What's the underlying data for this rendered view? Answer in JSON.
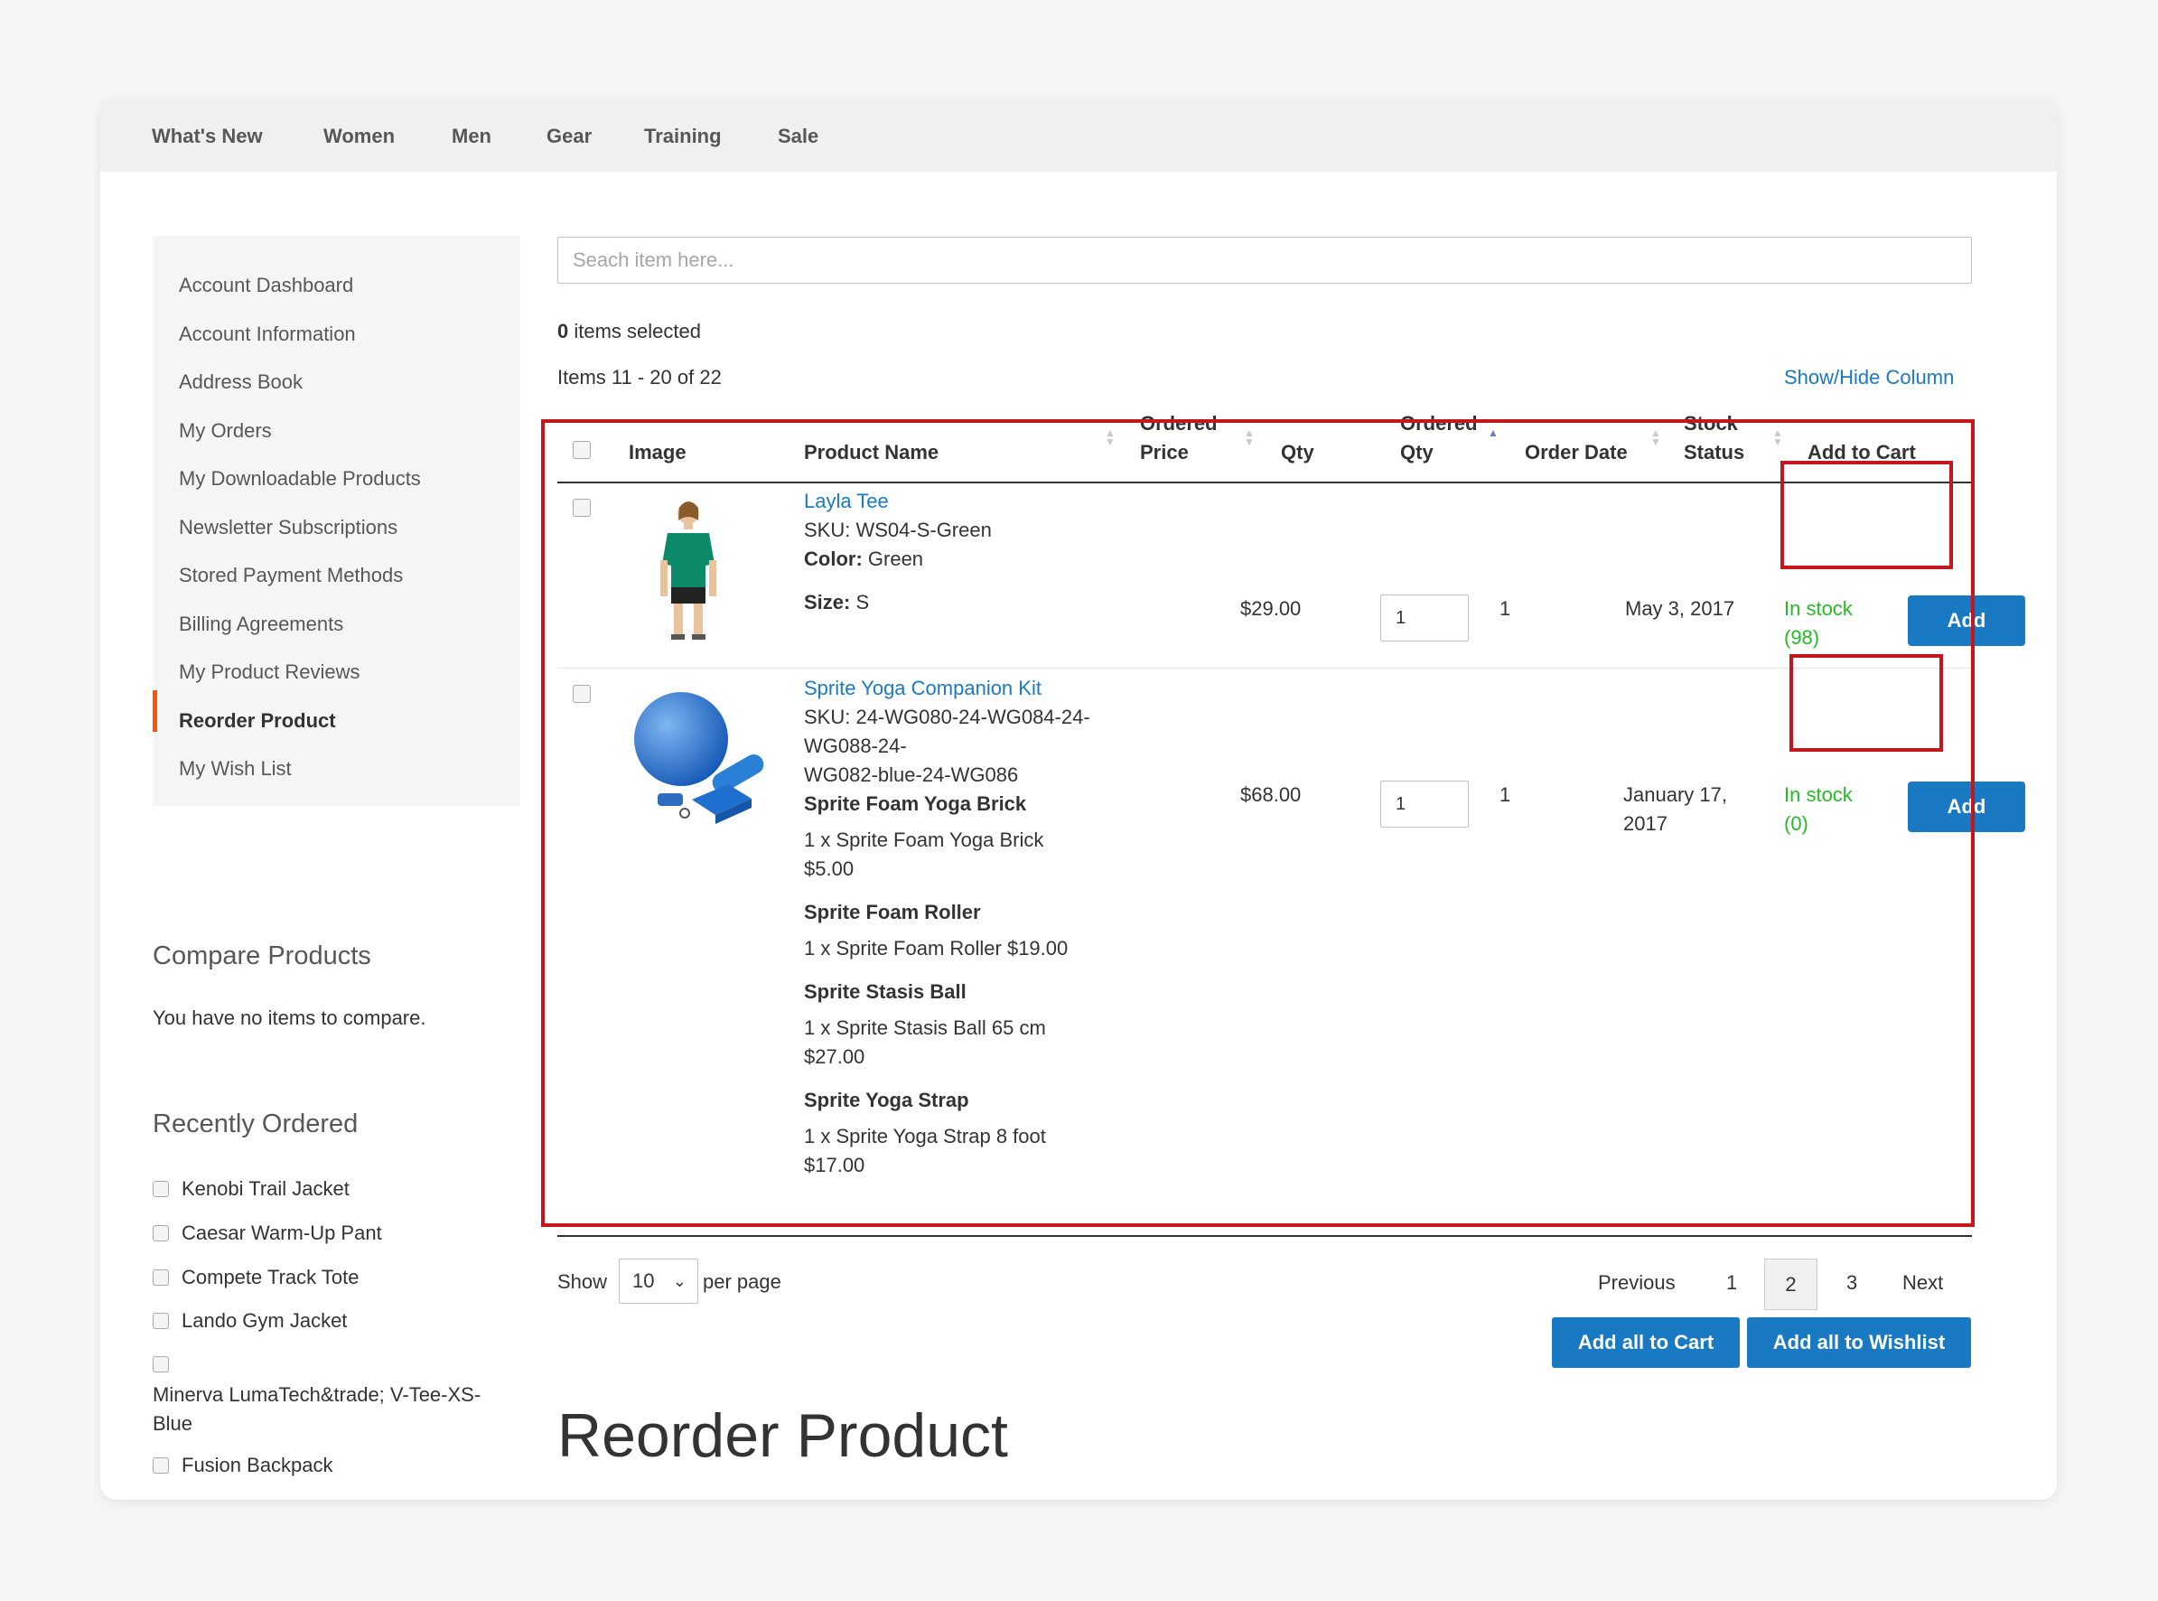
{
  "nav": {
    "items": [
      "What's New",
      "Women",
      "Men",
      "Gear",
      "Training",
      "Sale"
    ]
  },
  "sidebar": {
    "items": [
      "Account Dashboard",
      "Account Information",
      "Address Book",
      "My Orders",
      "My Downloadable Products",
      "Newsletter Subscriptions",
      "Stored Payment Methods",
      "Billing Agreements",
      "My Product Reviews",
      "Reorder Product",
      "My Wish List"
    ],
    "active": "Reorder Product"
  },
  "compare": {
    "title": "Compare Products",
    "empty_text": "You have no items to compare."
  },
  "recently_ordered": {
    "title": "Recently Ordered",
    "items": [
      "Kenobi Trail Jacket",
      "Caesar Warm-Up Pant",
      "Compete Track Tote",
      "Lando Gym Jacket",
      "Minerva LumaTech&trade; V-Tee-XS-Blue",
      "Fusion Backpack"
    ]
  },
  "search": {
    "placeholder": "Seach item here..."
  },
  "selection": {
    "count": "0",
    "label": " items selected"
  },
  "items_count": "Items 11 - 20 of 22",
  "show_hide": "Show/Hide Column",
  "table": {
    "headers": {
      "image": "Image",
      "product_name": "Product Name",
      "ordered_price_1": "Ordered",
      "ordered_price_2": "Price",
      "qty": "Qty",
      "ordered_qty_1": "Ordered",
      "ordered_qty_2": "Qty",
      "order_date": "Order Date",
      "stock_status_1": "Stock",
      "stock_status_2": "Status",
      "add_to_cart": "Add to Cart"
    },
    "rows": [
      {
        "name": "Layla Tee",
        "sku": "SKU: WS04-S-Green",
        "color_label": "Color:",
        "color": "Green",
        "size_label": "Size:",
        "size": "S",
        "price": "$29.00",
        "qty": "1",
        "ordered_qty": "1",
        "date": "May 3, 2017",
        "stock_line1": "In stock",
        "stock_line2": "(98)",
        "add": "Add"
      },
      {
        "name": "Sprite Yoga Companion Kit",
        "sku_lines": [
          "SKU: 24-WG080-24-WG084-24-",
          "WG088-24-",
          "WG082-blue-24-WG086"
        ],
        "bundle": [
          {
            "title": "Sprite Foam Yoga Brick",
            "lines": [
              "1 x Sprite Foam Yoga Brick",
              "$5.00"
            ]
          },
          {
            "title": "Sprite Foam Roller",
            "lines": [
              "1 x Sprite Foam Roller $19.00"
            ]
          },
          {
            "title": "Sprite Stasis Ball",
            "lines": [
              "1 x Sprite Stasis Ball 65 cm",
              "$27.00"
            ]
          },
          {
            "title": "Sprite Yoga Strap",
            "lines": [
              "1 x Sprite Yoga Strap 8 foot",
              "$17.00"
            ]
          }
        ],
        "price": "$68.00",
        "qty": "1",
        "ordered_qty": "1",
        "date_lines": [
          "January 17,",
          "2017"
        ],
        "stock_line1": "In stock",
        "stock_line2": "(0)",
        "add": "Add"
      }
    ]
  },
  "toolbar": {
    "show": "Show",
    "limiter": "10",
    "per_page": "per page",
    "previous": "Previous",
    "pages": [
      "1",
      "2",
      "3"
    ],
    "current_page": "2",
    "next": "Next",
    "add_all_cart": "Add all to Cart",
    "add_all_wishlist": "Add all to Wishlist"
  },
  "page_title": "Reorder Product",
  "colors": {
    "accent": "#1979c3",
    "instock": "#22bd22",
    "highlight": "#c4161c",
    "active_bar": "#ff5501"
  }
}
